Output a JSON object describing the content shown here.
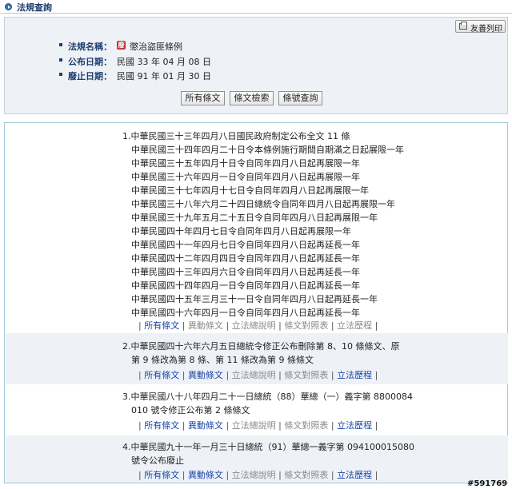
{
  "header": {
    "title": "法規查詢",
    "print_label": "友善列印"
  },
  "law": {
    "name_label": "法規名稱：",
    "name": "懲治盜匪條例",
    "name_icon_glyph": "廢",
    "announce_label": "公布日期：",
    "announce_date": "民國  33  年  04  月  08  日",
    "repeal_label": "廢止日期：",
    "repeal_date": "民國  91  年  01  月  30  日"
  },
  "buttons": {
    "all": "所有條文",
    "search": "條文檢索",
    "number": "條號查詢"
  },
  "history": [
    {
      "lines": [
        "1.中華民國三十三年四月八日國民政府制定公布全文  11  條",
        "中華民國三十四年四月二十日令本條例施行期間自期滿之日起展限一年",
        "中華民國三十五年四月十日令自同年四月八日起再展限一年",
        "中華民國三十六年四月一日令自同年四月八日起再展限一年",
        "中華民國三十七年四月十七日令自同年四月八日起再展限一年",
        "中華民國三十八年六月二十四日總統令自同年四月八日起再展限一年",
        "中華民國三十九年五月二十五日令自同年四月八日起再展限一年",
        "中華民國四十年四月七日令自同年四月八日起再展限一年",
        "中華民國四十一年四月七日令自同年四月八日起再延長一年",
        "中華民國四十二年四月四日令自同年四月八日起再延長一年",
        "中華民國四十三年四月六日令自同年四月八日起再延長一年",
        "中華民國四十四年四月一日令自同年四月八日起再延長一年",
        "中華民國四十五年三月三十一日令自同年四月八日起再延長一年",
        "中華民國四十六年四月一日令自同年四月八日起再延長一年"
      ],
      "links": [
        "所有條文",
        "異動條文",
        "立法總說明",
        "條文對照表",
        "立法歷程"
      ],
      "links_active": [
        true,
        false,
        false,
        false,
        false
      ]
    },
    {
      "lines": [
        "2.中華民國四十六年六月五日總統令修正公布刪除第  8、10  條條文、原",
        "第  9  條改為第  8  條、第  11  條改為第  9  條條文"
      ],
      "links": [
        "所有條文",
        "異動條文",
        "立法總說明",
        "條文對照表",
        "立法歷程"
      ],
      "links_active": [
        true,
        true,
        false,
        false,
        true
      ]
    },
    {
      "lines": [
        "3.中華民國八十八年四月二十一日總統（88）華總（一）義字第  8800084",
        "010  號令修正公布第  2  條條文"
      ],
      "links": [
        "所有條文",
        "異動條文",
        "立法總說明",
        "條文對照表",
        "立法歷程"
      ],
      "links_active": [
        true,
        true,
        false,
        false,
        true
      ]
    },
    {
      "lines": [
        "4.中華民國九十一年一月三十日總統（91）華總一義字第  094100015080",
        "號令公布廢止"
      ],
      "links": [
        "所有條文",
        "異動條文",
        "立法總說明",
        "條文對照表",
        "立法歷程"
      ],
      "links_active": [
        true,
        true,
        false,
        false,
        true
      ]
    }
  ],
  "watermark": "#591769"
}
